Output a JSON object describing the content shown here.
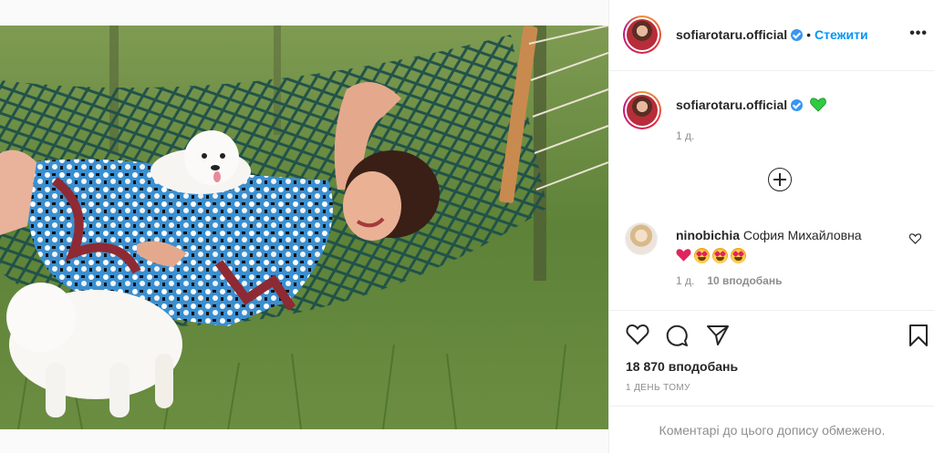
{
  "post": {
    "image_alt": "",
    "author": {
      "username": "sofiarotaru.official",
      "verified": true,
      "follow_label": "Стежити",
      "separator": "•",
      "more_label": "•••"
    },
    "caption": {
      "username": "sofiarotaru.official",
      "text_emoji": "green-heart",
      "time": "1 д."
    },
    "load_more_icon": "plus-circle-icon",
    "comments": [
      {
        "username": "ninobichia",
        "text": "София Михайловна",
        "emojis": [
          "red-heart",
          "heart-eyes",
          "heart-eyes",
          "heart-eyes"
        ],
        "time": "1 д.",
        "likes": "10 вподобань"
      }
    ],
    "actions": {
      "like_icon": "heart-icon",
      "comment_icon": "comment-icon",
      "share_icon": "send-icon",
      "save_icon": "bookmark-icon"
    },
    "likes_count": "18 870 вподобань",
    "date": "1 ДЕНЬ ТОМУ",
    "comments_limited": "Коментарі до цього допису обмежено.",
    "colors": {
      "link_blue": "#0095f6",
      "verified_blue": "#3897f0",
      "muted": "#8e8e8e",
      "green_heart": "#2ecc40",
      "red_heart": "#e0245e"
    }
  }
}
